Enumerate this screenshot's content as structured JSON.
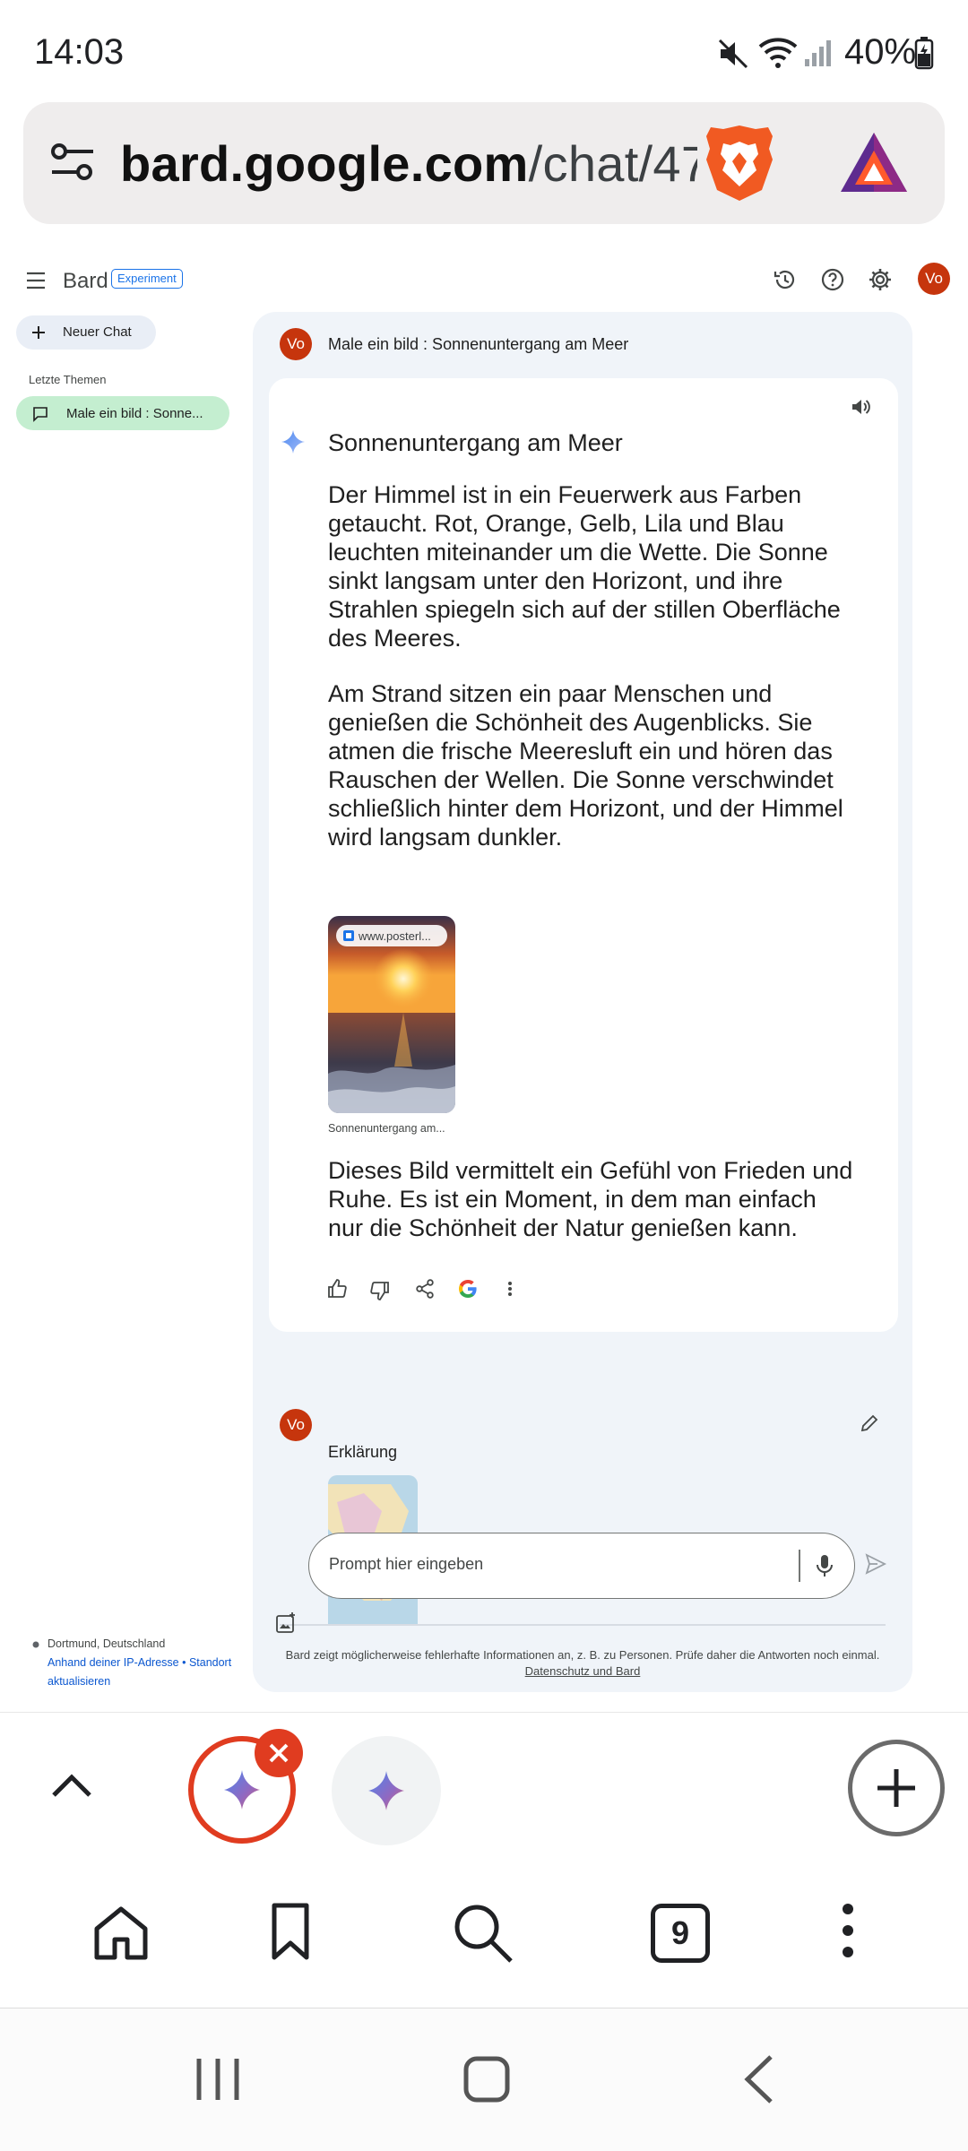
{
  "status_bar": {
    "time": "14:03",
    "battery": "40%"
  },
  "url_bar": {
    "host": "bard.google.com",
    "path": "/chat/47"
  },
  "bard": {
    "app_name": "Bard",
    "badge": "Experiment",
    "new_chat": "Neuer Chat",
    "recent_label": "Letzte Themen",
    "recent_items": [
      {
        "label": "Male ein bild : Sonne..."
      }
    ],
    "avatar_initials": "Vo",
    "location": {
      "place": "Dortmund, Deutschland",
      "line1": "Anhand deiner IP-Adresse • Standort",
      "line2": "aktualisieren"
    }
  },
  "chat": {
    "prompt": "Male ein bild : Sonnenuntergang am Meer",
    "response": {
      "title": "Sonnenuntergang am Meer",
      "paragraphs": [
        "Der Himmel ist in ein Feuerwerk aus Farben getaucht. Rot, Orange, Gelb, Lila und Blau leuchten miteinander um die Wette. Die Sonne sinkt langsam unter den Horizont, und ihre Strahlen spiegeln sich auf der stillen Oberfläche des Meeres.",
        "Am Strand sitzen ein paar Menschen und genießen die Schönheit des Augenblicks. Sie atmen die frische Meeresluft ein und hören das Rauschen der Wellen. Die Sonne verschwindet schließlich hinter dem Horizont, und der Himmel wird langsam dunkler.",
        "Dieses Bild vermittelt ein Gefühl von Frieden und Ruhe. Es ist ein Moment, in dem man einfach nur die Schönheit der Natur genießen kann."
      ],
      "image_source": "www.posterl...",
      "image_caption": "Sonnenuntergang am..."
    },
    "second_prompt": "Erklärung",
    "input_placeholder": "Prompt hier eingeben",
    "disclaimer": "Bard zeigt möglicherweise fehlerhafte Informationen an, z. B. zu Personen. Prüfe daher die Antworten noch einmal.",
    "disclaimer_link": "Datenschutz und Bard"
  },
  "browser": {
    "tab_count": "9"
  },
  "colors": {
    "accent_blue": "#0b57d0",
    "avatar": "#c6350d",
    "chat_bg": "#f0f4f9",
    "recent_active": "#c4eed0",
    "tab_close": "#e03c20"
  }
}
